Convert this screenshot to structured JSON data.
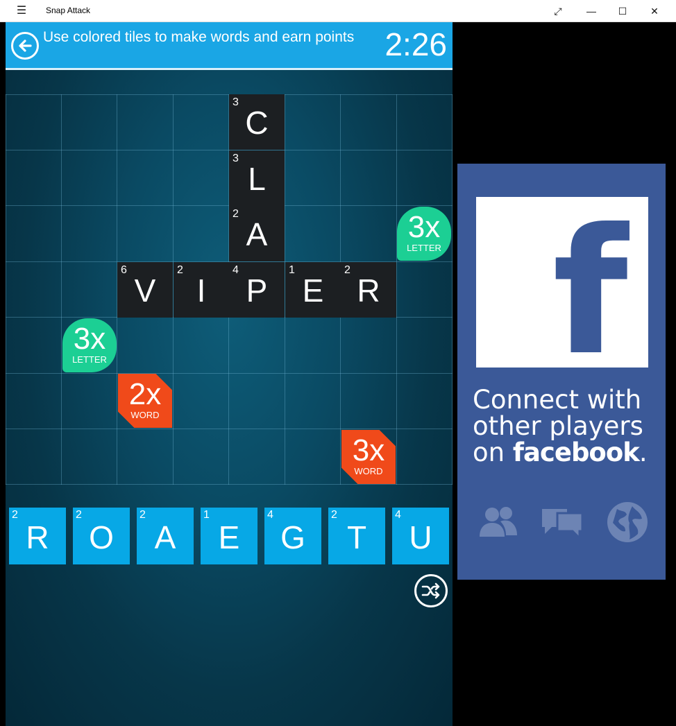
{
  "window": {
    "title": "Snap Attack",
    "menu_icon": "hamburger-icon",
    "controls": {
      "expand": "⤢",
      "minimize": "—",
      "maximize": "☐",
      "close": "✕"
    }
  },
  "header": {
    "instruction": "Use colored tiles to make words and earn points",
    "timer": "2:26",
    "back_icon": "back-arrow-icon",
    "color": "#1aa6e5"
  },
  "board": {
    "placed_tiles": [
      {
        "letter": "C",
        "points": "3"
      },
      {
        "letter": "L",
        "points": "3"
      },
      {
        "letter": "A",
        "points": "2"
      },
      {
        "letter": "V",
        "points": "6"
      },
      {
        "letter": "I",
        "points": "2"
      },
      {
        "letter": "P",
        "points": "4"
      },
      {
        "letter": "E",
        "points": "1"
      },
      {
        "letter": "R",
        "points": "2"
      }
    ],
    "bonuses": [
      {
        "mult": "3x",
        "kind": "LETTER",
        "color": "#1ccf94"
      },
      {
        "mult": "3x",
        "kind": "LETTER",
        "color": "#1ccf94"
      },
      {
        "mult": "2x",
        "kind": "WORD",
        "color": "#f04a1a"
      },
      {
        "mult": "3x",
        "kind": "WORD",
        "color": "#f04a1a"
      }
    ]
  },
  "rack": [
    {
      "letter": "R",
      "points": "2"
    },
    {
      "letter": "O",
      "points": "2"
    },
    {
      "letter": "A",
      "points": "2"
    },
    {
      "letter": "E",
      "points": "1"
    },
    {
      "letter": "G",
      "points": "4"
    },
    {
      "letter": "T",
      "points": "2"
    },
    {
      "letter": "U",
      "points": "4"
    }
  ],
  "shuffle_icon": "shuffle-icon",
  "ad": {
    "brand_icon": "facebook-f-icon",
    "line1": "Connect with",
    "line2": "other players",
    "line3_prefix": "on",
    "brand": "facebook",
    "brand_suffix": ".",
    "icons": [
      "friends-icon",
      "chat-icon",
      "globe-icon"
    ],
    "color": "#3b5998"
  }
}
